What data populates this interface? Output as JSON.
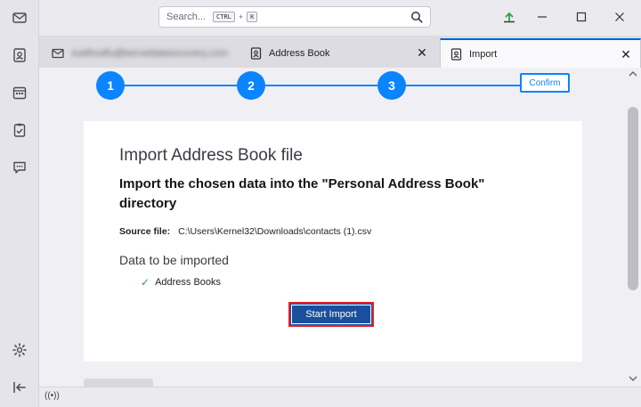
{
  "titlebar": {
    "search_placeholder": "Search...",
    "search_shortcut_key1": "CTRL",
    "search_shortcut_plus": "+",
    "search_shortcut_key2": "K"
  },
  "tabs": [
    {
      "label": "sutdhudfu@kerneldatarecovery.com",
      "icon": "envelope-icon",
      "blurred": true
    },
    {
      "label": "Address Book",
      "icon": "address-book-icon",
      "close": "✕"
    },
    {
      "label": "Import",
      "icon": "import-icon",
      "close": "✕",
      "active": true
    }
  ],
  "steps": {
    "items": [
      "1",
      "2",
      "3"
    ],
    "confirm_label": "Confirm",
    "accent_color": "#0a84ff"
  },
  "card": {
    "title": "Import Address Book file",
    "description": "Import the chosen data into the \"Personal Address Book\" directory",
    "source_label": "Source file:",
    "source_path": "C:\\Users\\Kernel32\\Downloads\\contacts (1).csv",
    "data_heading": "Data to be imported",
    "data_items": [
      {
        "check": "✓",
        "label": "Address Books"
      }
    ],
    "start_button": "Start Import"
  },
  "statusbar": {
    "connection_icon": "((•))"
  },
  "colors": {
    "primary_button": "#1a4f9c",
    "highlight_border": "#e0202a",
    "check_color": "#2ea043"
  }
}
